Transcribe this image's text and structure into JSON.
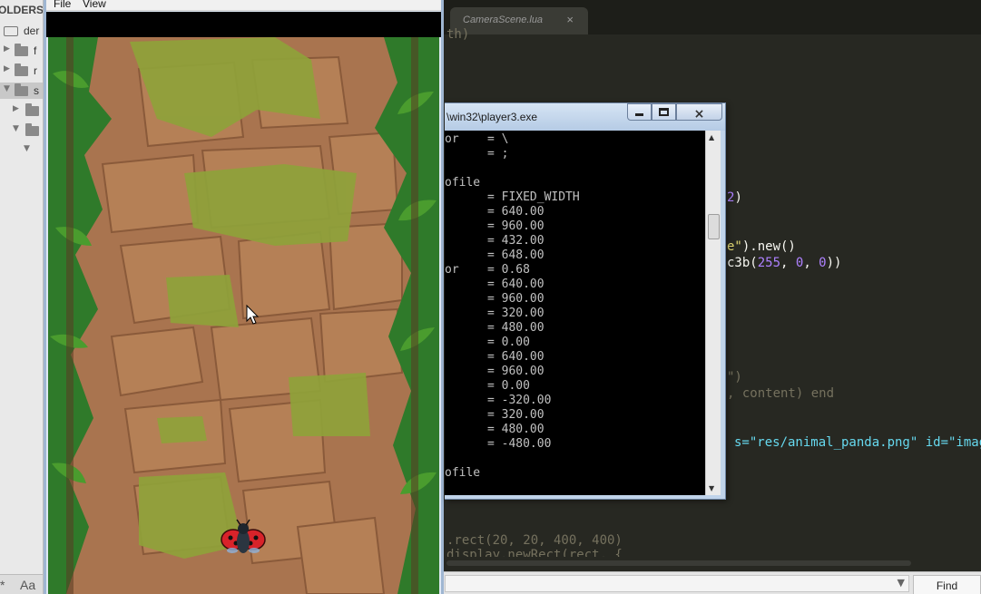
{
  "sidebar": {
    "header": "OLDERS",
    "items": [
      {
        "name": "der",
        "expanded": true
      },
      {
        "name": "f",
        "expanded": false
      },
      {
        "name": "r",
        "expanded": false
      },
      {
        "name": "s",
        "expanded": true
      }
    ],
    "bottom_label": "Aa",
    "bottom_star": "*"
  },
  "editor": {
    "tab_label": "CameraScene.lua",
    "tab_close": "×",
    "code_lines": [
      {
        "segments": [
          {
            "t": "th)",
            "c": "dim"
          }
        ]
      },
      {
        "segments": [
          {
            "t": "2",
            "c": "num"
          },
          {
            "t": ")",
            "c": ""
          }
        ]
      },
      {
        "segments": [
          {
            "t": "e\"",
            "c": "str"
          },
          {
            "t": ").new()",
            "c": ""
          }
        ]
      },
      {
        "segments": [
          {
            "t": "c3b(",
            "c": ""
          },
          {
            "t": "255",
            "c": "num"
          },
          {
            "t": ", ",
            "c": ""
          },
          {
            "t": "0",
            "c": "num"
          },
          {
            "t": ", ",
            "c": ""
          },
          {
            "t": "0",
            "c": "num"
          },
          {
            "t": "))",
            "c": ""
          }
        ]
      },
      {
        "segments": [
          {
            "t": "\")",
            "c": "dim"
          }
        ]
      },
      {
        "segments": [
          {
            "t": ", content) end",
            "c": "dim"
          }
        ]
      },
      {
        "segments": [
          {
            "t": "s=\"res/animal_panda.png\" id=\"imag",
            "c": "fn"
          }
        ]
      },
      {
        "segments": [
          {
            "t": ".rect(20, 20, 400, 400)",
            "c": "dim"
          }
        ]
      },
      {
        "segments": [
          {
            "t": "display.newRect(rect, {",
            "c": "dim"
          }
        ]
      }
    ],
    "find_button": "Find",
    "find_caret": "▼"
  },
  "player": {
    "menu": [
      "File",
      "View"
    ]
  },
  "console": {
    "title": "\\win32\\player3.exe",
    "btn_min": "minimize",
    "btn_max": "maximize",
    "btn_close": "×",
    "lines": [
      "or    = \\",
      "      = ;",
      "",
      "ofile",
      "      = FIXED_WIDTH",
      "      = 640.00",
      "      = 960.00",
      "      = 432.00",
      "      = 648.00",
      "or    = 0.68",
      "      = 640.00",
      "      = 960.00",
      "      = 320.00",
      "      = 480.00",
      "      = 0.00",
      "      = 640.00",
      "      = 960.00",
      "      = 0.00",
      "      = -320.00",
      "      = 320.00",
      "      = 480.00",
      "      = -480.00",
      "",
      "ofile"
    ]
  },
  "colors": {
    "path": "#a9744f",
    "grass": "#8fa23a",
    "jungle": "#2f7a2a",
    "ladybug": "#d8232a"
  }
}
